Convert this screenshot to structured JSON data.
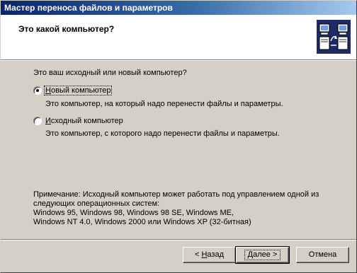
{
  "window": {
    "title": "Мастер переноса файлов и параметров"
  },
  "header": {
    "title": "Это какой компьютер?",
    "icon": "transfer-computers-icon"
  },
  "main": {
    "question": "Это ваш исходный или новый компьютер?",
    "options": [
      {
        "label_prefix": "",
        "label_hotkey": "Н",
        "label_rest": "овый компьютер",
        "description": "Это компьютер, на который надо перенести файлы и параметры.",
        "selected": true
      },
      {
        "label_prefix": "",
        "label_hotkey": "И",
        "label_rest": "сходный компьютер",
        "description": "Это компьютер, с которого надо перенести файлы и параметры.",
        "selected": false
      }
    ],
    "note_lines": [
      "Примечание: Исходный компьютер может работать под управлением одной из",
      "следующих операционных систем:",
      "Windows 95, Windows 98, Windows 98 SE, Windows ME,",
      "Windows NT 4.0, Windows 2000 или Windows XP (32-битная)"
    ]
  },
  "buttons": {
    "back": {
      "prefix": "< ",
      "hotkey": "Н",
      "rest": "азад"
    },
    "next": {
      "prefix": "",
      "hotkey": "Д",
      "rest": "алее >"
    },
    "cancel": {
      "label": "Отмена"
    }
  }
}
